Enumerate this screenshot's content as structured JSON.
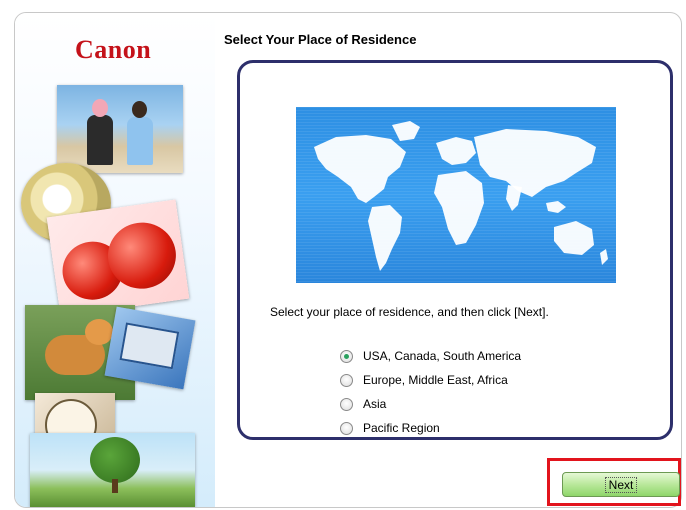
{
  "brand": {
    "logo_text": "Canon",
    "logo_color": "#c4121a"
  },
  "dialog": {
    "title": "Select Your Place of Residence",
    "instruction": "Select your place of residence, and then click [Next].",
    "options": [
      {
        "label": "USA, Canada, South America",
        "selected": true
      },
      {
        "label": "Europe, Middle East, Africa",
        "selected": false
      },
      {
        "label": "Asia",
        "selected": false
      },
      {
        "label": "Pacific Region",
        "selected": false
      }
    ],
    "next_label": "Next"
  },
  "colors": {
    "panel_border": "#2d2f6b",
    "map_blue": "#2d8fe3",
    "highlight_red": "#e2141d",
    "button_green": "#8fd66a"
  }
}
